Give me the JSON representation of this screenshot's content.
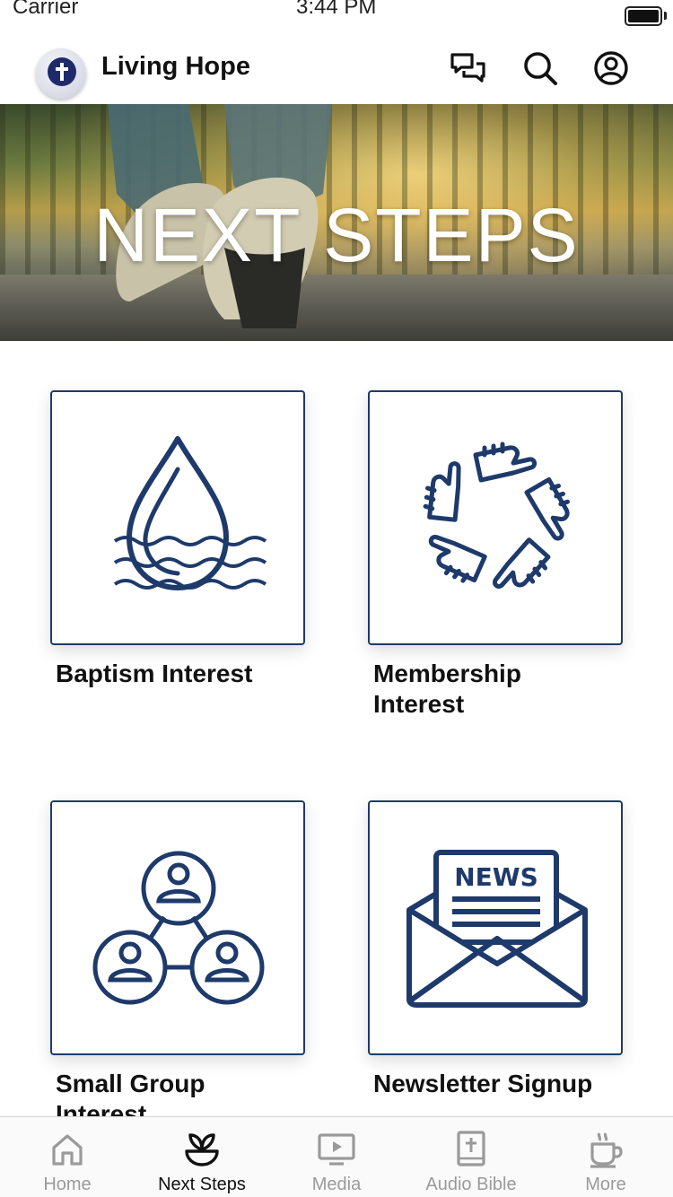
{
  "status_bar": {
    "carrier": "Carrier",
    "time": "3:44 PM"
  },
  "header": {
    "title": "Living Hope",
    "icons": [
      "chat-icon",
      "search-icon",
      "account-icon"
    ]
  },
  "hero": {
    "title": "NEXT STEPS"
  },
  "cards": [
    {
      "label": "Baptism Interest",
      "icon": "water-drop-icon"
    },
    {
      "label": "Membership\nInterest",
      "icon": "joined-hands-icon"
    },
    {
      "label": "Small Group\nInterest",
      "icon": "group-network-icon"
    },
    {
      "label": "Newsletter Signup",
      "icon": "newsletter-envelope-icon"
    }
  ],
  "tabs": [
    {
      "label": "Home",
      "icon": "home-icon",
      "active": false
    },
    {
      "label": "Next Steps",
      "icon": "sprout-icon",
      "active": true
    },
    {
      "label": "Media",
      "icon": "media-play-icon",
      "active": false
    },
    {
      "label": "Audio Bible",
      "icon": "bible-icon",
      "active": false
    },
    {
      "label": "More",
      "icon": "coffee-cup-icon",
      "active": false
    }
  ],
  "colors": {
    "accent_navy": "#1e3a6b",
    "tab_inactive": "#9a9a9a",
    "tab_active": "#111111"
  },
  "newsletter_icon_text": "NEWS"
}
